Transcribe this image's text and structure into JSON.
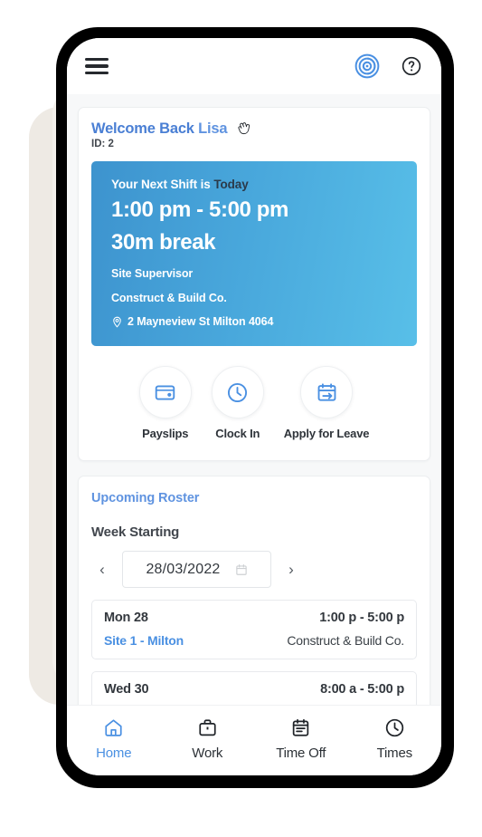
{
  "appbar": {
    "menu_icon": "hamburger-menu-icon",
    "logo_icon": "app-logo-spiral-icon",
    "help_icon": "help-question-icon"
  },
  "welcome": {
    "greeting": "Welcome Back ",
    "name": "Lisa",
    "wave_icon": "waving-hand-icon",
    "employee_id": "ID: 2"
  },
  "shift": {
    "heading_prefix": "Your Next Shift is ",
    "heading_day": "Today",
    "time_range": "1:00 pm - 5:00 pm",
    "break": "30m break",
    "role": "Site Supervisor",
    "company": "Construct & Build Co.",
    "address": "2 Mayneview St Milton 4064",
    "pin_icon": "location-pin-icon",
    "gradient_from": "#3d93ce",
    "gradient_to": "#58bfe8"
  },
  "actions": [
    {
      "label": "Payslips",
      "icon": "wallet-payslip-icon"
    },
    {
      "label": "Clock In",
      "icon": "clock-icon"
    },
    {
      "label": "Apply for Leave",
      "icon": "calendar-leave-arrow-icon"
    }
  ],
  "roster": {
    "title": "Upcoming Roster",
    "week_label": "Week Starting",
    "prev_icon": "chevron-left-icon",
    "next_icon": "chevron-right-icon",
    "date_value": "28/03/2022",
    "calendar_icon": "calendar-icon",
    "rows": [
      {
        "day": "Mon 28",
        "time": "1:00 p - 5:00 p",
        "site": "Site 1 - Milton",
        "company": "Construct & Build Co."
      },
      {
        "day": "Wed 30",
        "time": "8:00 a - 5:00 p",
        "site": "",
        "company": ""
      }
    ]
  },
  "bottom_nav": {
    "items": [
      {
        "label": "Home",
        "icon": "home-icon",
        "active": true
      },
      {
        "label": "Work",
        "icon": "briefcase-icon",
        "active": false
      },
      {
        "label": "Time Off",
        "icon": "calendar-timeoff-icon",
        "active": false
      },
      {
        "label": "Times",
        "icon": "clock-times-icon",
        "active": false
      }
    ],
    "active_color": "#4a90e2"
  }
}
